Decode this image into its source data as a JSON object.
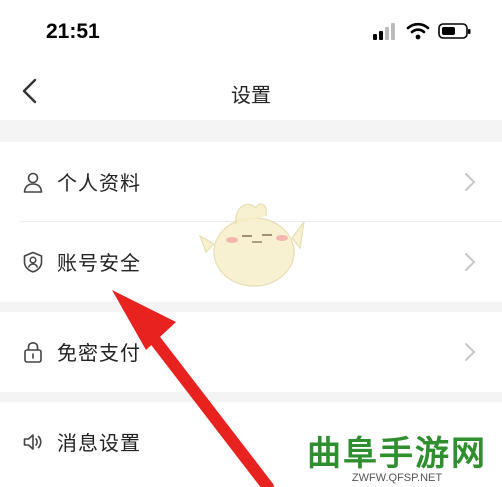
{
  "status_bar": {
    "time": "21:51",
    "icons": [
      "signal-icon",
      "wifi-icon",
      "battery-icon"
    ]
  },
  "nav": {
    "title": "设置",
    "back_icon": "chevron-left-icon"
  },
  "settings": {
    "items": [
      {
        "label": "个人资料",
        "icon": "person-icon"
      },
      {
        "label": "账号安全",
        "icon": "shield-user-icon"
      },
      {
        "label": "免密支付",
        "icon": "lock-icon"
      },
      {
        "label": "消息设置",
        "icon": "speaker-icon"
      }
    ]
  },
  "overlay": {
    "arrow_color": "#e8231f",
    "mascot": "chick-mascot"
  },
  "watermark": {
    "title": "曲阜手游网",
    "url": "ZWFW.QFSP.NET",
    "title_color": "#2f8f2f"
  }
}
